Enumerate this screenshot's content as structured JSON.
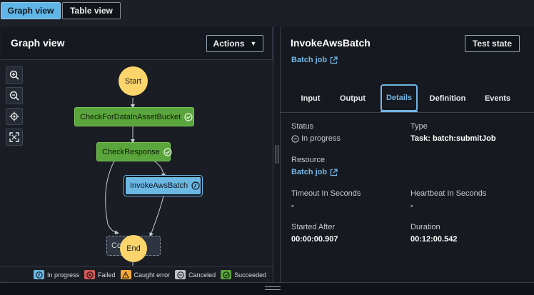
{
  "view_toggle": {
    "graph_label": "Graph view",
    "table_label": "Table view"
  },
  "graph_panel": {
    "title": "Graph view",
    "actions_label": "Actions",
    "zoom_controls": [
      "zoom-in-icon",
      "zoom-out-icon",
      "center-icon",
      "fit-icon"
    ],
    "nodes": {
      "start": "Start",
      "check_data": "CheckForDataInAssetBucket",
      "check_response": "CheckResponse",
      "invoke": "InvokeAwsBatch",
      "complete": "Complete",
      "end": "End"
    },
    "legend": [
      {
        "label": "In progress",
        "color": "#6bb8e3"
      },
      {
        "label": "Failed",
        "color": "#d45b5b"
      },
      {
        "label": "Caught error",
        "color": "#f2a93b"
      },
      {
        "label": "Canceled",
        "color": "#bfc4cc"
      },
      {
        "label": "Succeeded",
        "color": "#5ba63c"
      }
    ]
  },
  "detail_panel": {
    "title": "InvokeAwsBatch",
    "test_state_label": "Test state",
    "batch_link": "Batch job",
    "tabs": [
      "Input",
      "Output",
      "Details",
      "Definition",
      "Events"
    ],
    "active_tab": "Details",
    "fields": {
      "status_label": "Status",
      "status_value": "In progress",
      "type_label": "Type",
      "type_value": "Task: batch:submitJob",
      "resource_label": "Resource",
      "resource_value": "Batch job",
      "timeout_label": "Timeout In Seconds",
      "timeout_value": "-",
      "heartbeat_label": "Heartbeat In Seconds",
      "heartbeat_value": "-",
      "started_label": "Started After",
      "started_value": "00:00:00.907",
      "duration_label": "Duration",
      "duration_value": "00:12:00.542"
    }
  }
}
